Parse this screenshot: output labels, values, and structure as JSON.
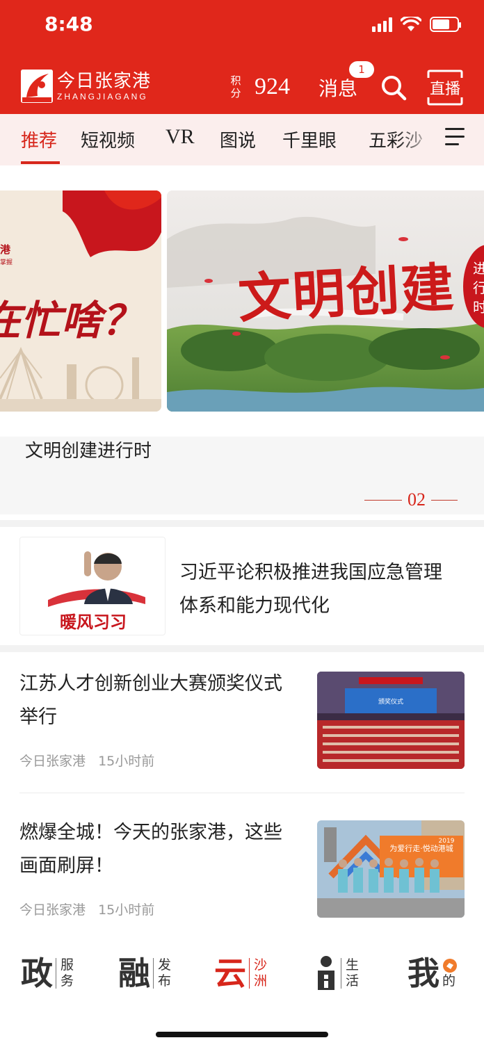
{
  "status_bar": {
    "time": "8:48"
  },
  "header": {
    "logo_cn": "今日张家港",
    "logo_en": "ZHANGJIAGANG",
    "logo_mark_text": "今日张家港",
    "points_label_1": "积",
    "points_label_2": "分",
    "points_value": "924",
    "messages_label": "消息",
    "messages_badge": "1",
    "live_label": "直播",
    "accent_color": "#e0271b"
  },
  "tabs": [
    {
      "label": "推荐",
      "active": true
    },
    {
      "label": "短视频"
    },
    {
      "label": "VR"
    },
    {
      "label": "图说"
    },
    {
      "label": "千里眼"
    },
    {
      "label": "五彩沙"
    }
  ],
  "carousel": {
    "left_card": {
      "brand": "港",
      "brand_sub": "掌握",
      "headline": "在忙啥？"
    },
    "main_card": {
      "banner_title": "文明创建",
      "seal_chars": [
        "进",
        "行",
        "时"
      ]
    },
    "caption": "文明创建进行时",
    "page": "02"
  },
  "featured": {
    "tag": "暖风习习",
    "title": "习近平论积极推进我国应急管理体系和能力现代化"
  },
  "news": [
    {
      "title": "江苏人才创新创业大赛颁奖仪式举行",
      "source": "今日张家港",
      "time": "15小时前",
      "thumb_text": "颁奖仪式"
    },
    {
      "title": "燃爆全城！今天的张家港，这些画面刷屏！",
      "source": "今日张家港",
      "time": "15小时前",
      "thumb_text_1": "为爱行走·悦动港城",
      "thumb_text_2": "2019"
    }
  ],
  "bottom_nav": [
    {
      "big": "政",
      "small_1": "服",
      "small_2": "务"
    },
    {
      "big": "融",
      "small_1": "发",
      "small_2": "布"
    },
    {
      "big": "云",
      "small_1": "沙",
      "small_2": "洲",
      "active": true
    },
    {
      "big": "",
      "small_1": "生",
      "small_2": "活",
      "icon": "info-person-icon"
    },
    {
      "big": "我",
      "small_1": "的",
      "small_2": ""
    }
  ]
}
